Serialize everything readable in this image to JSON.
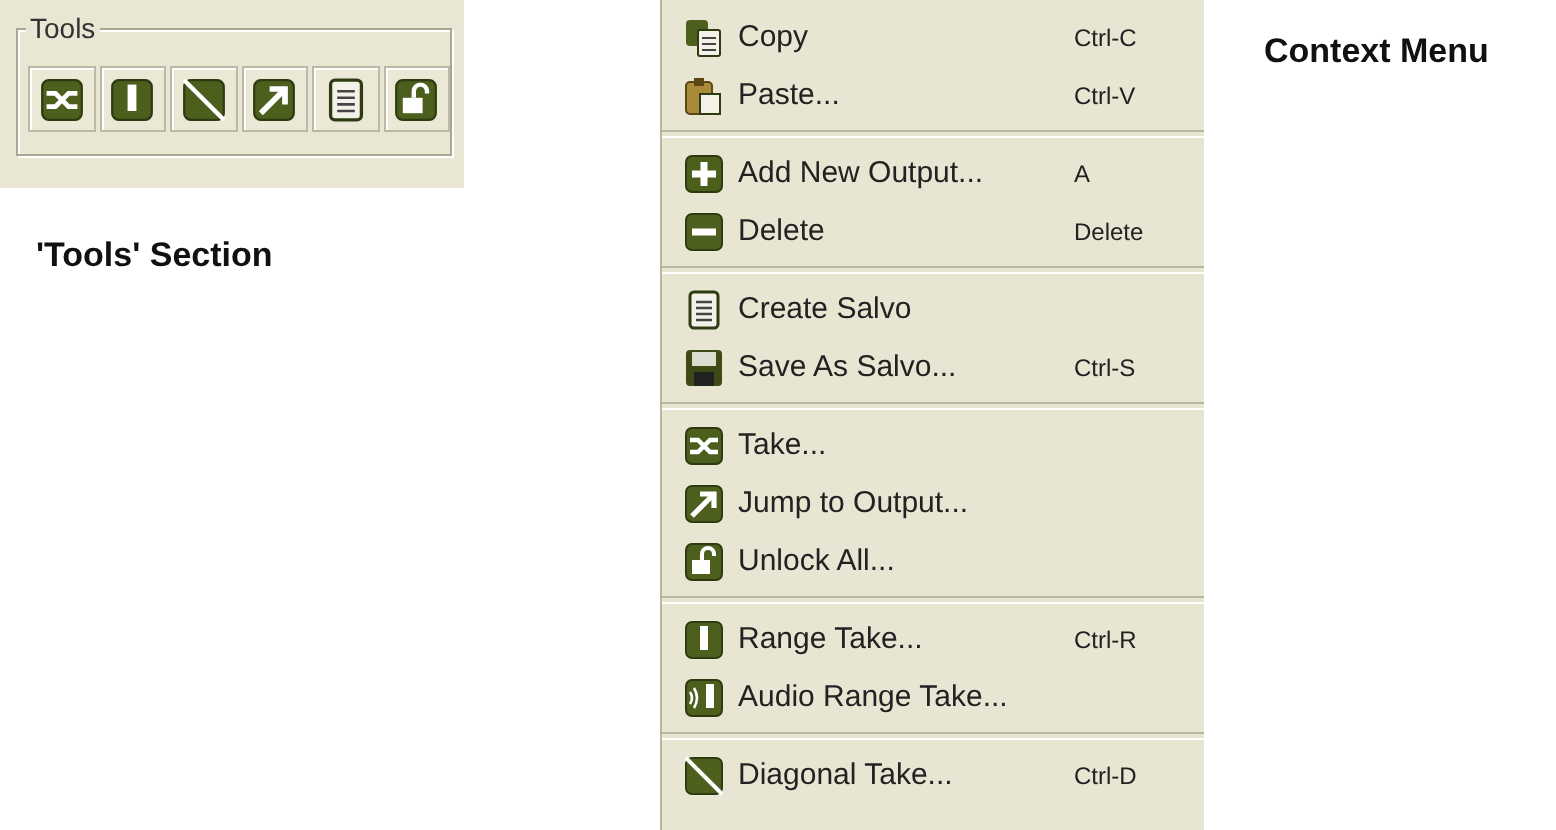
{
  "tools_panel": {
    "title": "Tools"
  },
  "tools_caption": "'Tools' Section",
  "context_menu": {
    "groups": [
      [
        {
          "label": "Copy",
          "shortcut": "Ctrl-C"
        },
        {
          "label": "Paste...",
          "shortcut": "Ctrl-V"
        }
      ],
      [
        {
          "label": "Add New Output...",
          "shortcut": "A"
        },
        {
          "label": "Delete",
          "shortcut": "Delete"
        }
      ],
      [
        {
          "label": "Create Salvo"
        },
        {
          "label": "Save As Salvo...",
          "shortcut": "Ctrl-S"
        }
      ],
      [
        {
          "label": "Take..."
        },
        {
          "label": "Jump to Output..."
        },
        {
          "label": "Unlock All..."
        }
      ],
      [
        {
          "label": "Range Take...",
          "shortcut": "Ctrl-R"
        },
        {
          "label": "Audio Range Take..."
        }
      ],
      [
        {
          "label": "Diagonal Take...",
          "shortcut": "Ctrl-D"
        }
      ]
    ]
  },
  "menu_caption": "Context Menu"
}
